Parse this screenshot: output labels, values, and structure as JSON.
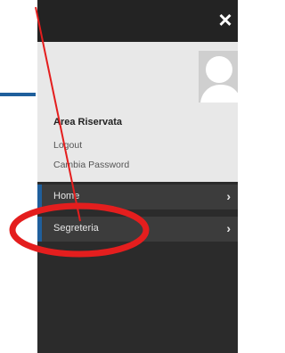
{
  "colors": {
    "accent": "#1f5f9c",
    "drawer_bg": "#2b2b2b",
    "profile_bg": "#e8e8e8",
    "annotation_red": "#e41e1e"
  },
  "drawer": {
    "close_icon": "×",
    "profile": {
      "avatar_icon": "user-avatar",
      "title": "Area Riservata",
      "links": [
        "Logout",
        "Cambia Password"
      ]
    },
    "menu": [
      {
        "label": "Home",
        "chevron": "›"
      },
      {
        "label": "Segreteria",
        "chevron": "›"
      }
    ]
  }
}
